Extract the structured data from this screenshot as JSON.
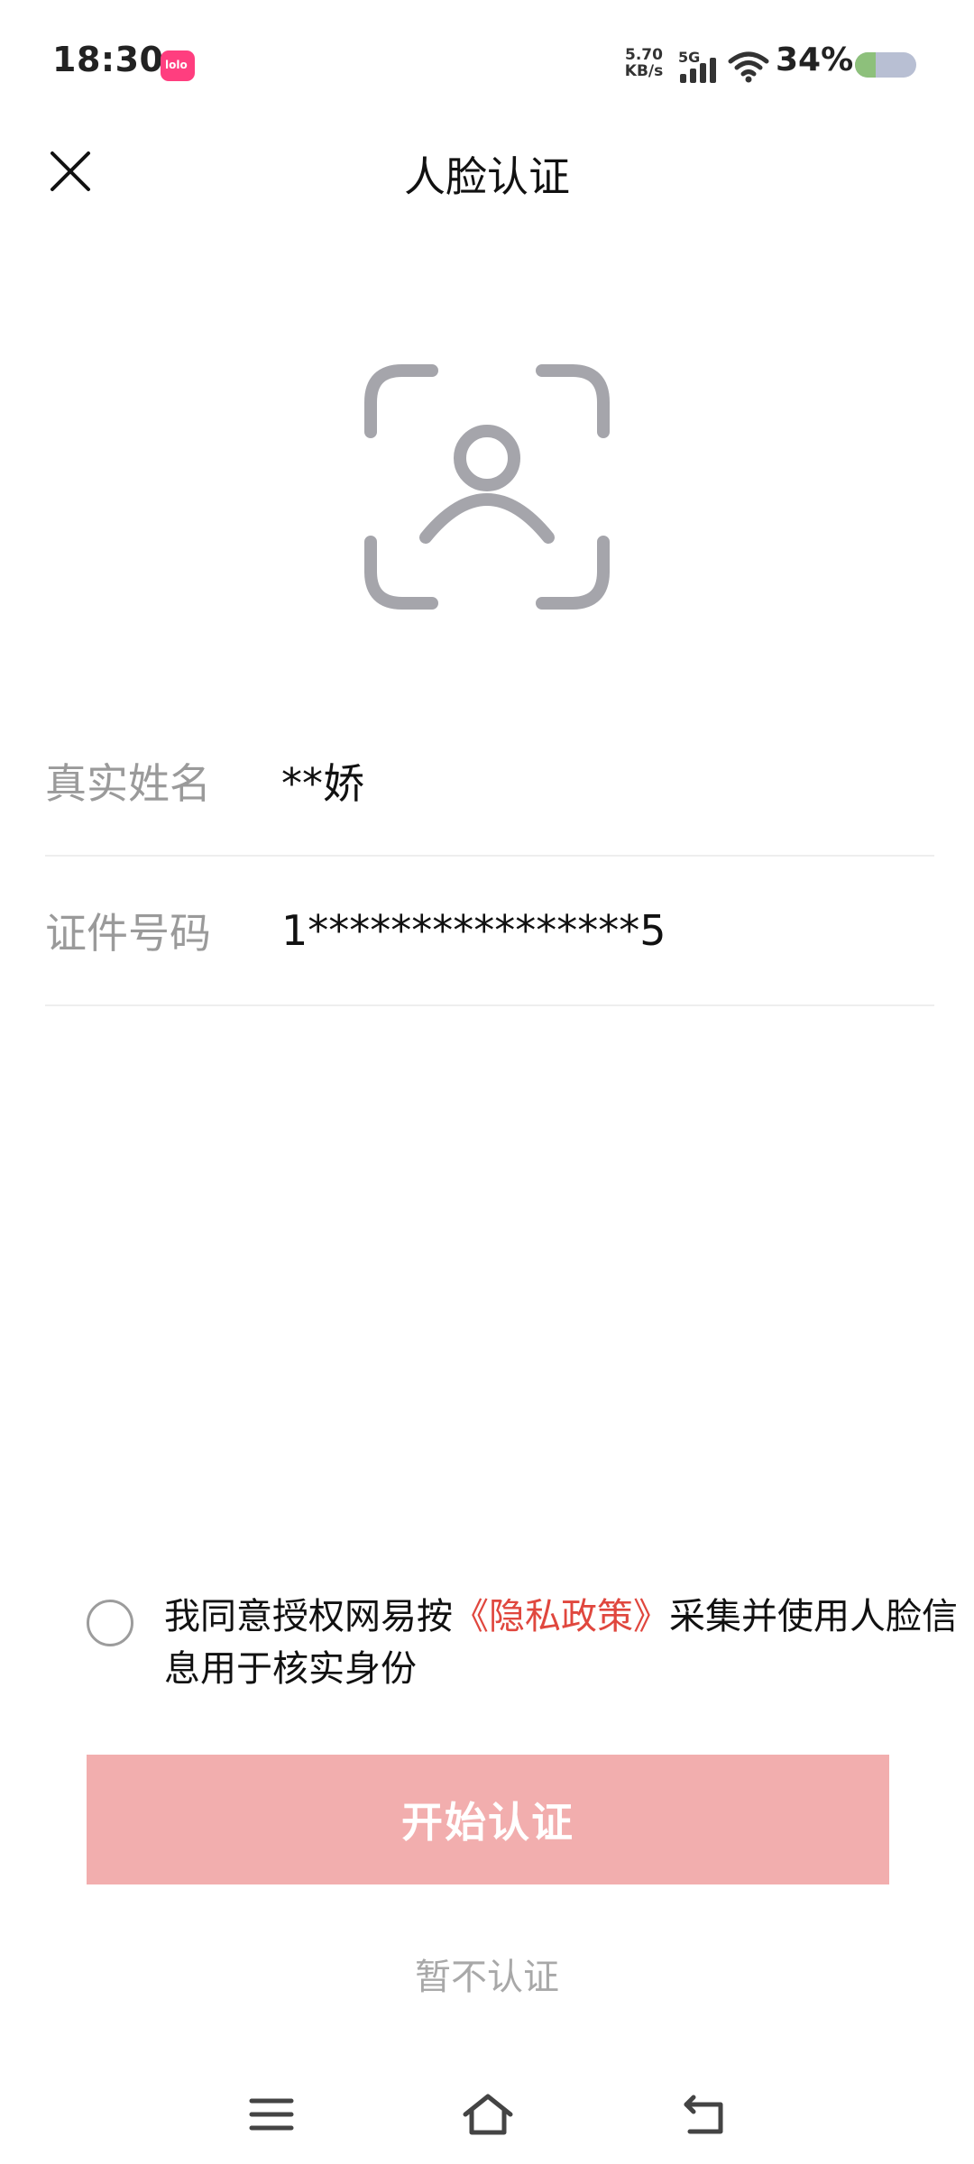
{
  "status_bar": {
    "time": "18:30",
    "app_badge_text": "lolo",
    "net_speed_value": "5.70",
    "net_speed_unit": "KB/s",
    "network_type": "5G",
    "battery_percent": "34%",
    "battery_level": 0.34,
    "colors": {
      "badge": "#ff3e7f",
      "battery_fill": "#8dc07b",
      "battery_bg": "#b8bfd3"
    }
  },
  "header": {
    "title": "人脸认证",
    "close_icon": "close-icon"
  },
  "face_icon": "face-scan-icon",
  "form": {
    "name_label": "真实姓名",
    "name_value": "**娇",
    "id_label": "证件号码",
    "id_value": "1****************5"
  },
  "agreement": {
    "checked": false,
    "text_before": "我同意授权网易按",
    "link_text": "《隐私政策》",
    "text_after": "采集并使用人脸信息用于核实身份",
    "link_color": "#e0473e"
  },
  "actions": {
    "start_label": "开始认证",
    "skip_label": "暂不认证",
    "start_color": "#f2aeae"
  },
  "nav_bar": {
    "menu_icon": "menu-icon",
    "home_icon": "home-icon",
    "back_icon": "back-icon"
  }
}
